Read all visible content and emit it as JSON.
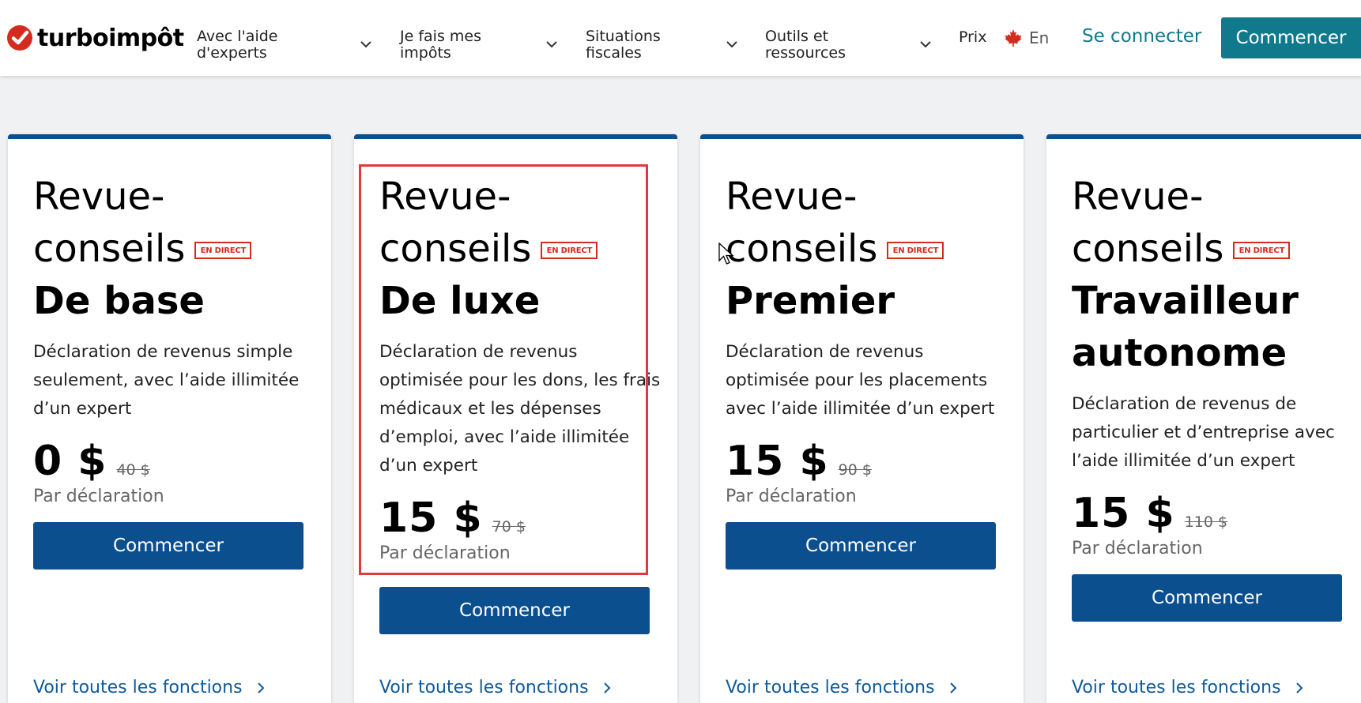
{
  "header": {
    "logo_text": "turboimpôt",
    "nav": [
      {
        "label": "Avec l'aide\nd'experts"
      },
      {
        "label": "Je fais mes\nimpôts"
      },
      {
        "label": "Situations\nfiscales"
      },
      {
        "label": "Outils et\nressources"
      }
    ],
    "prix": "Prix",
    "lang": "En",
    "signin": "Se connecter",
    "start": "Commencer"
  },
  "cards": [
    {
      "title_line1": "Revue-",
      "title_line2": "conseils",
      "badge": "EN DIRECT",
      "plan": "De base",
      "description": "Déclaration de revenus simple seulement, avec l’aide illimitée d’un expert",
      "price": "0 $",
      "old_price": "40 $",
      "per": "Par déclaration",
      "button": "Commencer",
      "link": "Voir toutes les fonctions"
    },
    {
      "title_line1": "Revue-",
      "title_line2": "conseils",
      "badge": "EN DIRECT",
      "plan": "De luxe",
      "description": "Déclaration de revenus optimisée pour les dons, les frais médicaux et les dépenses d’emploi, avec l’aide illimitée d’un expert",
      "price": "15 $",
      "old_price": "70 $",
      "per": "Par déclaration",
      "button": "Commencer",
      "link": "Voir toutes les fonctions"
    },
    {
      "title_line1": "Revue-",
      "title_line2": "conseils",
      "badge": "EN DIRECT",
      "plan": "Premier",
      "description": "Déclaration de revenus optimisée pour les placements avec l’aide illimitée d’un expert",
      "price": "15 $",
      "old_price": "90 $",
      "per": "Par déclaration",
      "button": "Commencer",
      "link": "Voir toutes les fonctions"
    },
    {
      "title_line1": "Revue-",
      "title_line2": "conseils",
      "badge": "EN DIRECT",
      "plan": "Travailleur autonome",
      "description": "Déclaration de revenus de particulier et d’entreprise avec l’aide illimitée d’un expert",
      "price": "15 $",
      "old_price": "110 $",
      "per": "Par déclaration",
      "button": "Commencer",
      "link": "Voir toutes les fonctions"
    }
  ],
  "colors": {
    "brand_teal": "#107a8c",
    "card_blue": "#0b4f8e",
    "live_red": "#d52b1e",
    "highlight_red": "#e0393e",
    "logo_red": "#d52b1e"
  },
  "icons": [
    "check-logo-icon",
    "chevron-down-icon",
    "maple-leaf-icon",
    "chevron-right-icon",
    "mouse-cursor-icon"
  ]
}
